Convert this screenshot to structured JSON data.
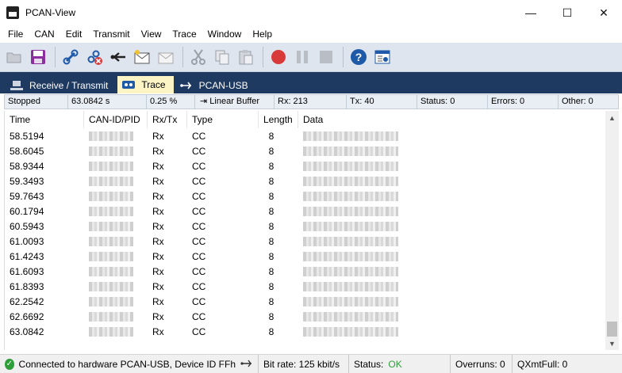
{
  "window": {
    "title": "PCAN-View"
  },
  "menu": [
    "File",
    "CAN",
    "Edit",
    "Transmit",
    "View",
    "Trace",
    "Window",
    "Help"
  ],
  "toolbar": {
    "buttons": [
      "folder-open-icon",
      "save-icon",
      "connect-icon",
      "disconnect-icon",
      "reset-icon",
      "new-message-icon",
      "message-icon",
      "cut-icon",
      "copy-icon",
      "paste-icon",
      "record-icon",
      "pause-icon",
      "stop-icon",
      "help-icon",
      "properties-icon"
    ]
  },
  "tabs": [
    {
      "label": "Receive / Transmit",
      "icon": "network-icon",
      "active": false
    },
    {
      "label": "Trace",
      "icon": "trace-icon",
      "active": true
    },
    {
      "label": "PCAN-USB",
      "icon": "usb-icon",
      "active": false
    }
  ],
  "trace_status": {
    "state": "Stopped",
    "time": "63.0842 s",
    "buffer_pct": "0.25 %",
    "buffer_mode": "Linear Buffer",
    "rx": "Rx: 213",
    "tx": "Tx: 40",
    "status": "Status: 0",
    "errors": "Errors: 0",
    "other": "Other: 0"
  },
  "columns": [
    "Time",
    "CAN-ID/PID",
    "Rx/Tx",
    "Type",
    "Length",
    "Data"
  ],
  "rows": [
    {
      "time": "58.5194",
      "rxtx": "Rx",
      "type": "CC",
      "length": "8"
    },
    {
      "time": "58.6045",
      "rxtx": "Rx",
      "type": "CC",
      "length": "8"
    },
    {
      "time": "58.9344",
      "rxtx": "Rx",
      "type": "CC",
      "length": "8"
    },
    {
      "time": "59.3493",
      "rxtx": "Rx",
      "type": "CC",
      "length": "8"
    },
    {
      "time": "59.7643",
      "rxtx": "Rx",
      "type": "CC",
      "length": "8"
    },
    {
      "time": "60.1794",
      "rxtx": "Rx",
      "type": "CC",
      "length": "8"
    },
    {
      "time": "60.5943",
      "rxtx": "Rx",
      "type": "CC",
      "length": "8"
    },
    {
      "time": "61.0093",
      "rxtx": "Rx",
      "type": "CC",
      "length": "8"
    },
    {
      "time": "61.4243",
      "rxtx": "Rx",
      "type": "CC",
      "length": "8"
    },
    {
      "time": "61.6093",
      "rxtx": "Rx",
      "type": "CC",
      "length": "8"
    },
    {
      "time": "61.8393",
      "rxtx": "Rx",
      "type": "CC",
      "length": "8"
    },
    {
      "time": "62.2542",
      "rxtx": "Rx",
      "type": "CC",
      "length": "8"
    },
    {
      "time": "62.6692",
      "rxtx": "Rx",
      "type": "CC",
      "length": "8"
    },
    {
      "time": "63.0842",
      "rxtx": "Rx",
      "type": "CC",
      "length": "8"
    }
  ],
  "statusbar": {
    "connection": "Connected to hardware PCAN-USB, Device ID FFh",
    "bitrate": "Bit rate: 125 kbit/s",
    "status_label": "Status:",
    "status_value": "OK",
    "overruns": "Overruns: 0",
    "qxmtfull": "QXmtFull: 0"
  },
  "colors": {
    "accent": "#1f3a60",
    "active_tab": "#fdf4c6",
    "ok": "#2e9d3a",
    "record": "#d83a3a",
    "help": "#1e5aa8"
  }
}
